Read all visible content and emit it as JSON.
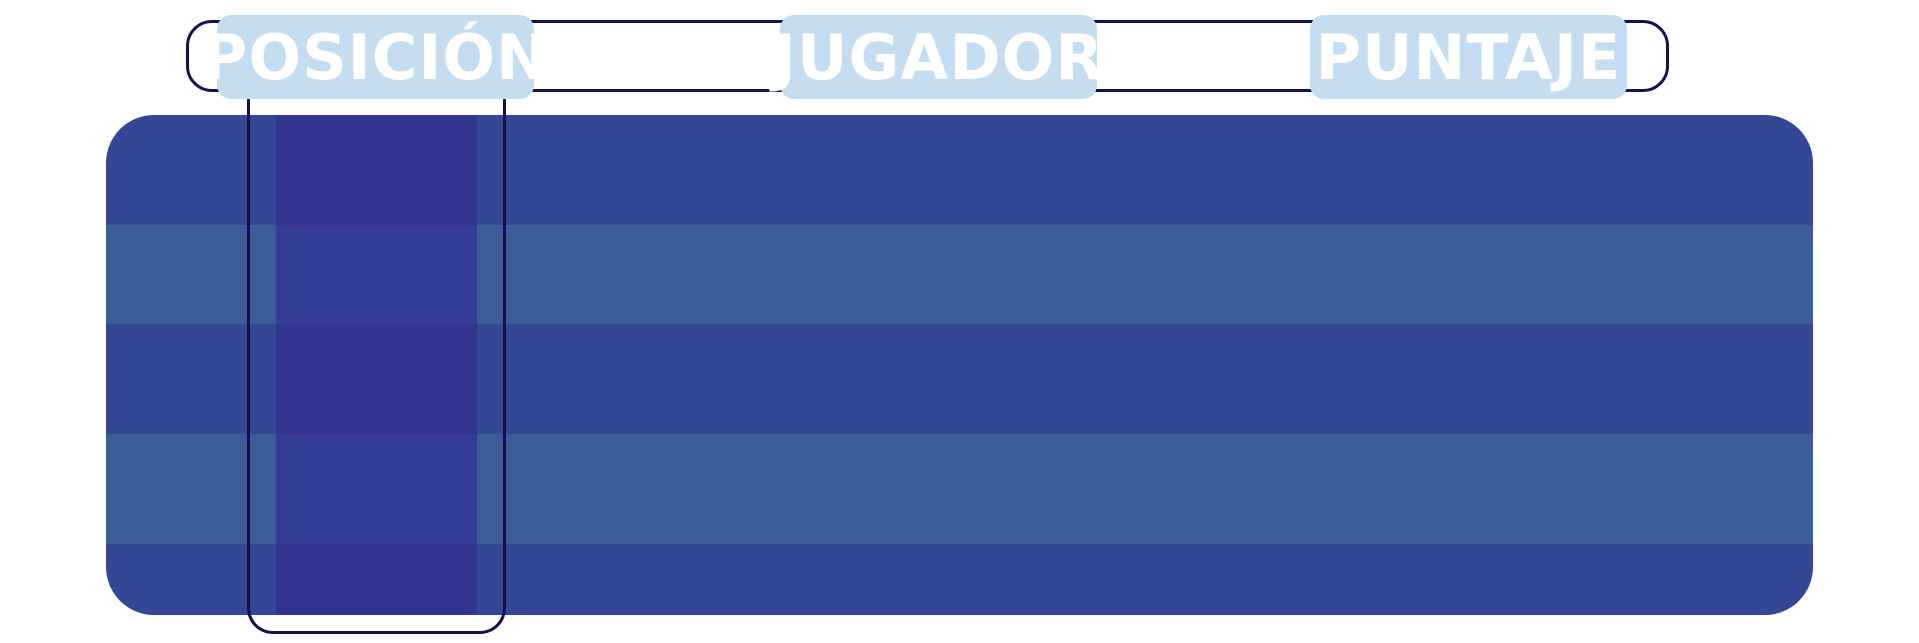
{
  "header": {
    "columns": [
      {
        "label": "POSICIÓN"
      },
      {
        "label": "JUGADOR"
      },
      {
        "label": "PUNTAJE"
      }
    ]
  },
  "colors": {
    "chip": "#c5ddf0",
    "row_dark": "#344794",
    "row_light": "#3d5c9a",
    "col_highlight_dark": "#31358f",
    "col_highlight_light": "#343d95",
    "outline": "#14114f"
  },
  "board": {
    "row_count": 5
  }
}
